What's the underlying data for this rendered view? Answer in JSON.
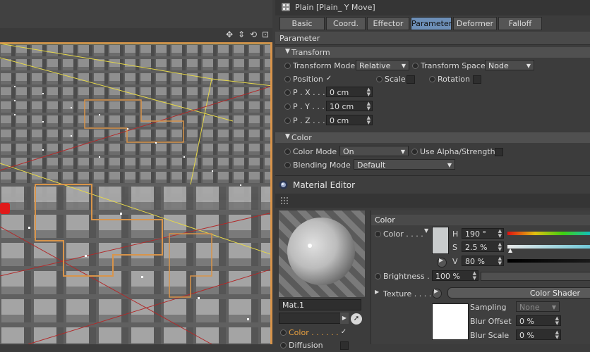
{
  "attribute_manager": {
    "object_title": "Plain [Plain_ Y Move]",
    "tabs": [
      {
        "label": "Basic",
        "active": false
      },
      {
        "label": "Coord.",
        "active": false
      },
      {
        "label": "Effector",
        "active": false
      },
      {
        "label": "Parameter",
        "active": true
      },
      {
        "label": "Deformer",
        "active": false
      },
      {
        "label": "Falloff",
        "active": false
      }
    ],
    "section_title": "Parameter",
    "transform_group": {
      "title": "Transform",
      "transform_mode_label": "Transform Mode",
      "transform_mode_value": "Relative",
      "transform_space_label": "Transform Space",
      "transform_space_value": "Node",
      "position_label": "Position",
      "position_checked": true,
      "scale_label": "Scale",
      "rotation_label": "Rotation",
      "px_label": "P . X . . . .",
      "px_value": "0 cm",
      "py_label": "P . Y . . . .",
      "py_value": "10 cm",
      "pz_label": "P . Z . . . .",
      "pz_value": "0 cm"
    },
    "color_group": {
      "title": "Color",
      "color_mode_label": "Color Mode",
      "color_mode_value": "On",
      "use_alpha_label": "Use Alpha/Strength",
      "blending_mode_label": "Blending Mode",
      "blending_mode_value": "Default"
    },
    "check_mark": "✓"
  },
  "material_editor": {
    "title": "Material Editor",
    "material_name": "Mat.1",
    "channels": [
      {
        "label": "Color . . . . . .",
        "checked": true,
        "active": true
      },
      {
        "label": "Diffusion",
        "checked": false,
        "active": false
      }
    ],
    "color_section": {
      "title": "Color",
      "color_label": "Color . . . .",
      "swatch_color": "#c9cccd",
      "h_label": "H",
      "h_value": "190 °",
      "s_label": "S",
      "s_value": "2.5 %",
      "v_label": "V",
      "v_value": "80 %",
      "brightness_label": "Brightness . .",
      "brightness_value": "100 %",
      "texture_label": "Texture . . . . .",
      "texture_button": "Color Shader",
      "sampling_label": "Sampling",
      "sampling_value": "None",
      "blur_offset_label": "Blur Offset",
      "blur_offset_value": "0 %",
      "blur_scale_label": "Blur Scale",
      "blur_scale_value": "0 %"
    }
  },
  "colors": {
    "selection_orange": "#d8944a",
    "active_tab": "#6d8fb8",
    "panel_bg": "#3c3c3c"
  }
}
